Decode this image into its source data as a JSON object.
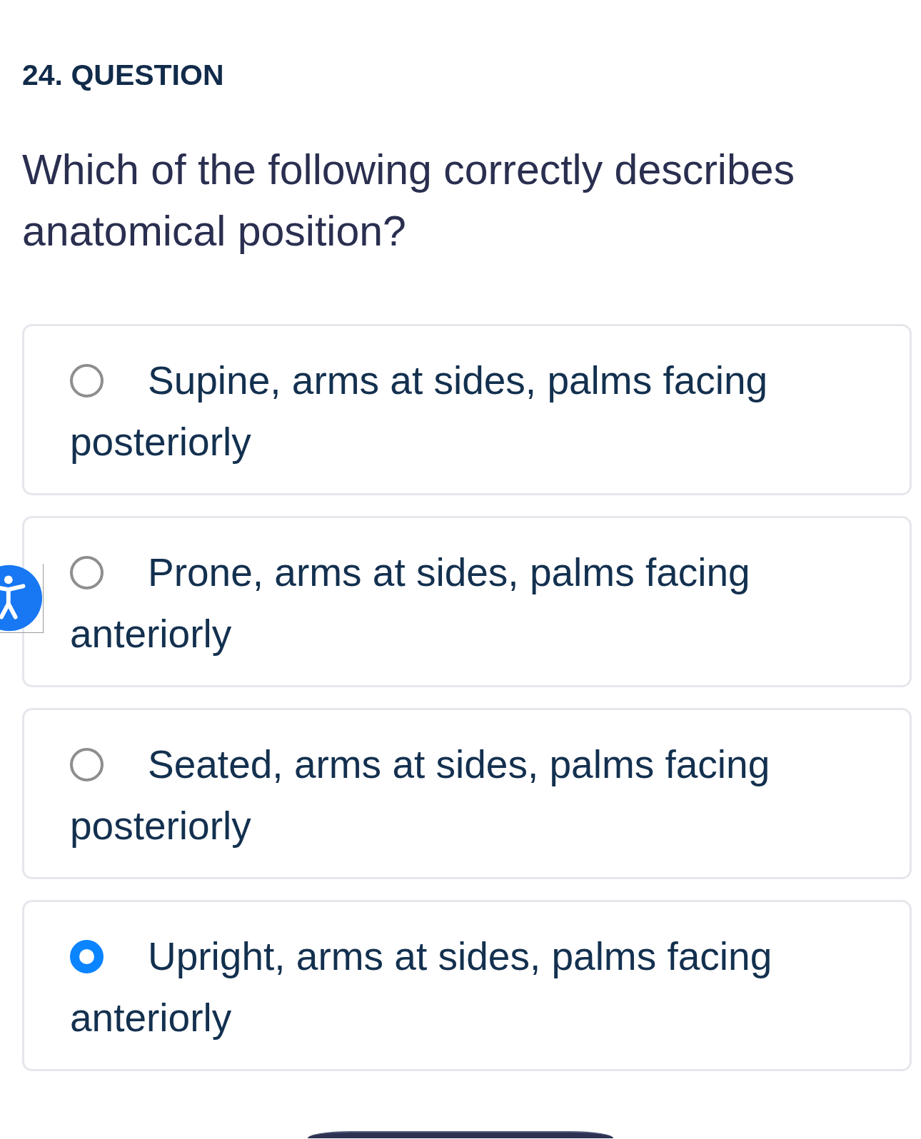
{
  "heading": "24. QUESTION",
  "question": "Which of the following correctly describes anatomical position?",
  "options": [
    {
      "label": "Supine, arms at sides, palms facing posteriorly",
      "selected": false
    },
    {
      "label": "Prone, arms at sides, palms facing anteriorly",
      "selected": false
    },
    {
      "label": "Seated, arms at sides, palms facing posteriorly",
      "selected": false
    },
    {
      "label": "Upright, arms at sides, palms facing anteriorly",
      "selected": true
    }
  ]
}
